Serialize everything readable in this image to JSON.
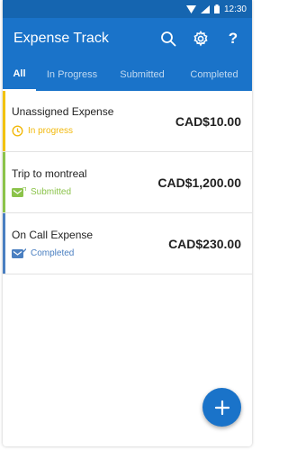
{
  "status_bar": {
    "time": "12:30"
  },
  "app_bar": {
    "title": "Expense Track",
    "icons": [
      "search-icon",
      "gear-icon",
      "help-icon"
    ],
    "help_glyph": "?"
  },
  "tabs": [
    {
      "label": "All",
      "active": true
    },
    {
      "label": "In Progress",
      "active": false
    },
    {
      "label": "Submitted",
      "active": false
    },
    {
      "label": "Completed",
      "active": false
    }
  ],
  "expenses": [
    {
      "name": "Unassigned Expense",
      "status": "In progress",
      "amount": "CAD$10.00",
      "status_color": "#f2b90c",
      "status_icon": "clock-icon"
    },
    {
      "name": "Trip to montreal",
      "status": "Submitted",
      "amount": "CAD$1,200.00",
      "status_color": "#8bc34a",
      "status_icon": "submitted-icon"
    },
    {
      "name": "On Call Expense",
      "status": "Completed",
      "amount": "CAD$230.00",
      "status_color": "#4a7fc1",
      "status_icon": "completed-icon"
    }
  ],
  "fab": {
    "icon": "plus-icon"
  },
  "colors": {
    "primary": "#1a73c9",
    "status_bar": "#1565b0"
  }
}
